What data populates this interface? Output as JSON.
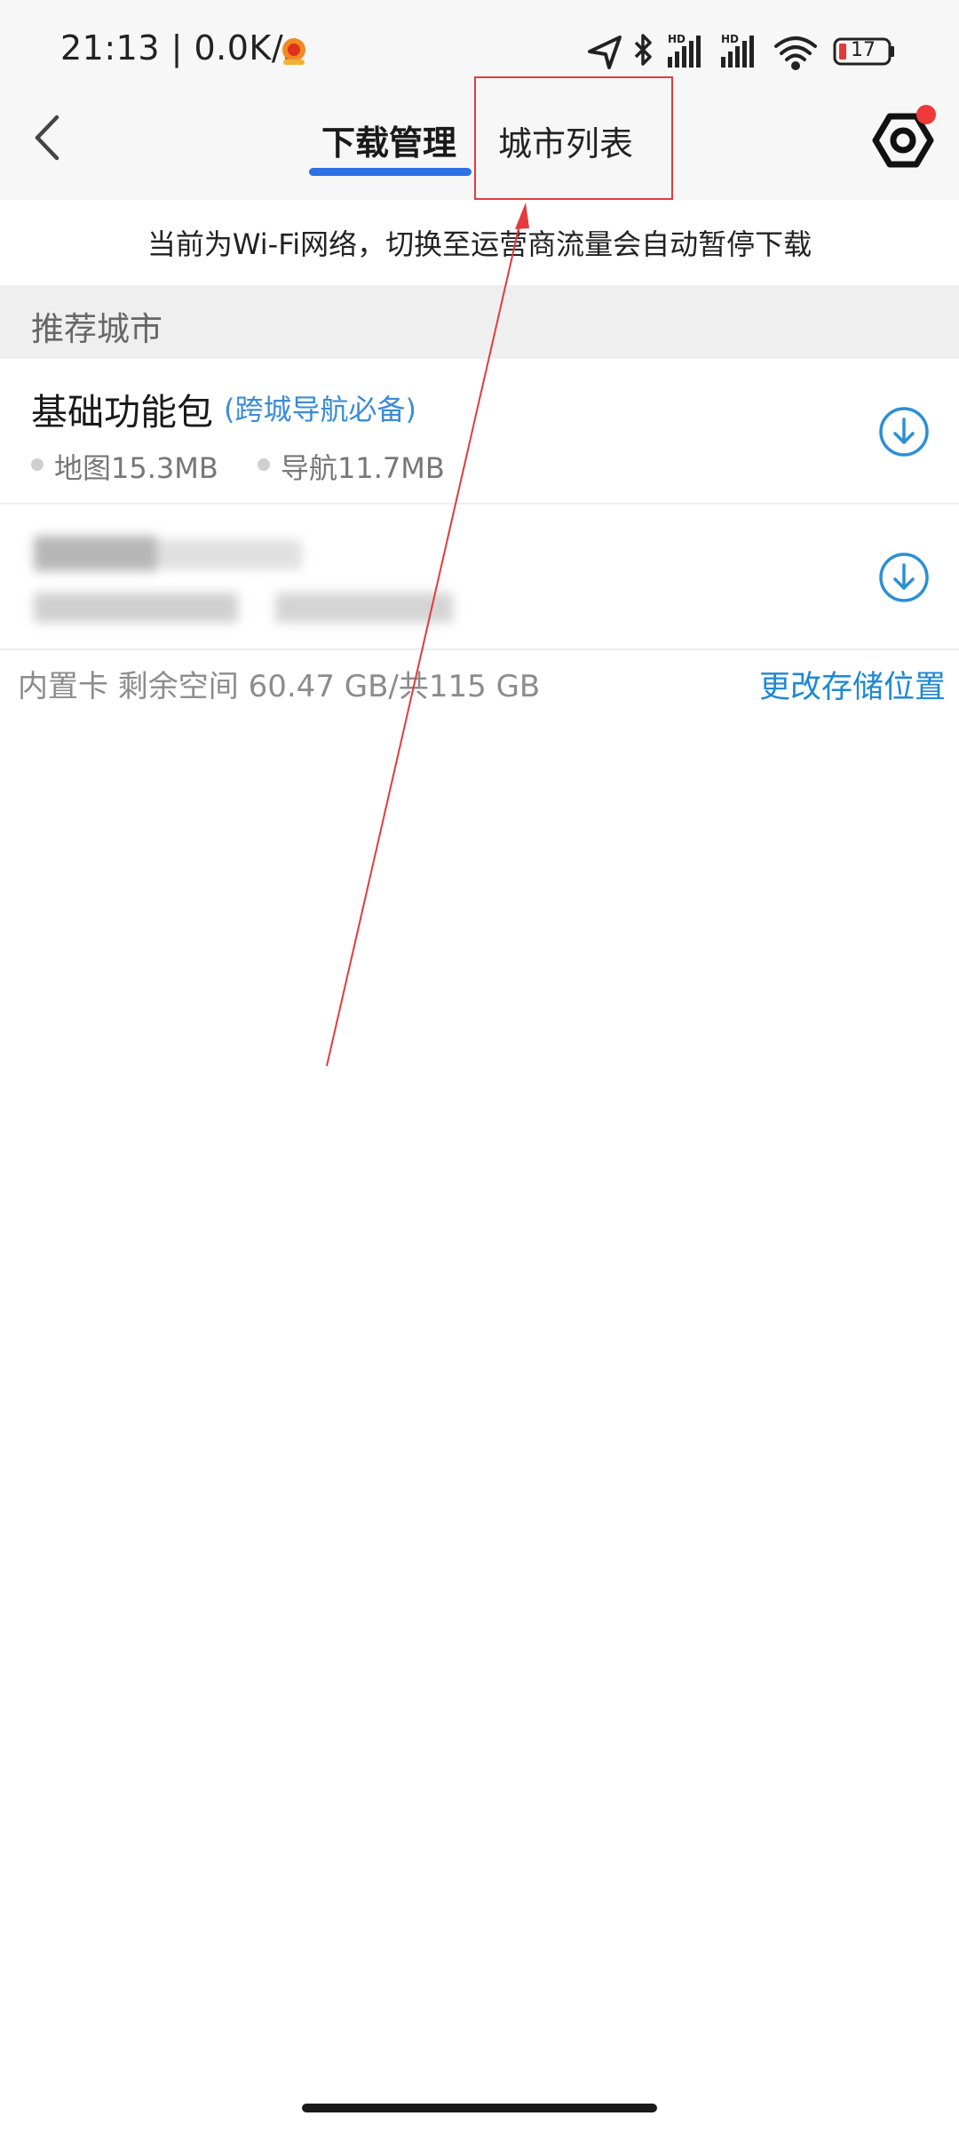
{
  "status_bar": {
    "time": "21:13 | 0.0K/s",
    "battery_level": "17"
  },
  "header": {
    "back_icon": "chevron-left-icon",
    "tabs": [
      {
        "label": "下载管理",
        "active": true
      },
      {
        "label": "城市列表",
        "active": false
      }
    ],
    "settings_icon": "hexagon-settings-icon"
  },
  "notice": "当前为Wi-Fi网络，切换至运营商流量会自动暂停下载",
  "recommended": {
    "section_title": "推荐城市",
    "items": [
      {
        "title": "基础功能包",
        "subtitle": "(跨城导航必备)",
        "map_size": "地图15.3MB",
        "nav_size": "导航11.7MB"
      }
    ]
  },
  "storage": {
    "info": "内置卡 剩余空间 60.47 GB/共115 GB",
    "change_label": "更改存储位置"
  },
  "colors": {
    "accent": "#2c72e6",
    "link": "#1f88d3",
    "annotation": "#e33a3a"
  }
}
